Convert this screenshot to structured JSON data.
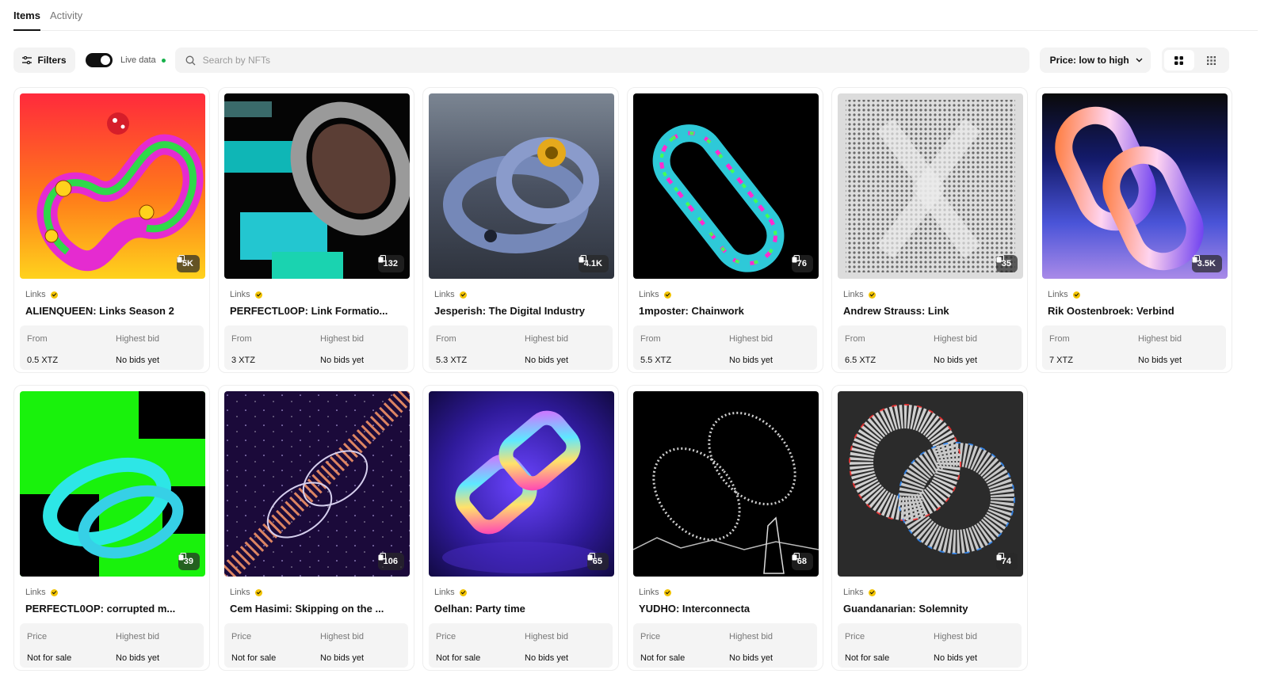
{
  "tabs": [
    {
      "label": "Items"
    },
    {
      "label": "Activity"
    }
  ],
  "toolbar": {
    "filters_label": "Filters",
    "live_label": "Live data",
    "search_placeholder": "Search by NFTs",
    "sort_label": "Price: low to high"
  },
  "icons": {
    "filters": "sliders-icon",
    "search": "search-icon",
    "sort_chevron": "chevron-down-icon",
    "grid_large": "grid-large-icon",
    "grid_small": "grid-small-icon",
    "editions": "editions-icon",
    "verified": "verified-badge-icon"
  },
  "colors": {
    "live_dot": "#16b14a",
    "verified": "#f2c300"
  },
  "items": [
    {
      "editions": "5K",
      "collection": "Links",
      "name": "ALIENQUEEN: Links Season 2",
      "label1": "From",
      "value1": "0.5 XTZ",
      "label2": "Highest bid",
      "value2": "No bids yet"
    },
    {
      "editions": "132",
      "collection": "Links",
      "name": "PERFECTL0OP: Link Formatio...",
      "label1": "From",
      "value1": "3 XTZ",
      "label2": "Highest bid",
      "value2": "No bids yet"
    },
    {
      "editions": "4.1K",
      "collection": "Links",
      "name": "Jesperish: The Digital Industry",
      "label1": "From",
      "value1": "5.3 XTZ",
      "label2": "Highest bid",
      "value2": "No bids yet"
    },
    {
      "editions": "76",
      "collection": "Links",
      "name": "1mposter: Chainwork",
      "label1": "From",
      "value1": "5.5 XTZ",
      "label2": "Highest bid",
      "value2": "No bids yet"
    },
    {
      "editions": "35",
      "collection": "Links",
      "name": "Andrew Strauss: Link",
      "label1": "From",
      "value1": "6.5 XTZ",
      "label2": "Highest bid",
      "value2": "No bids yet"
    },
    {
      "editions": "3.5K",
      "collection": "Links",
      "name": "Rik Oostenbroek: Verbind",
      "label1": "From",
      "value1": "7 XTZ",
      "label2": "Highest bid",
      "value2": "No bids yet"
    },
    {
      "editions": "39",
      "collection": "Links",
      "name": "PERFECTL0OP: corrupted m...",
      "label1": "Price",
      "value1": "Not for sale",
      "label2": "Highest bid",
      "value2": "No bids yet"
    },
    {
      "editions": "106",
      "collection": "Links",
      "name": "Cem Hasimi: Skipping on the ...",
      "label1": "Price",
      "value1": "Not for sale",
      "label2": "Highest bid",
      "value2": "No bids yet"
    },
    {
      "editions": "65",
      "collection": "Links",
      "name": "Oelhan: Party time",
      "label1": "Price",
      "value1": "Not for sale",
      "label2": "Highest bid",
      "value2": "No bids yet"
    },
    {
      "editions": "68",
      "collection": "Links",
      "name": "YUDHO: Interconnecta",
      "label1": "Price",
      "value1": "Not for sale",
      "label2": "Highest bid",
      "value2": "No bids yet"
    },
    {
      "editions": "74",
      "collection": "Links",
      "name": "Guandanarian: Solemnity",
      "label1": "Price",
      "value1": "Not for sale",
      "label2": "Highest bid",
      "value2": "No bids yet"
    }
  ]
}
